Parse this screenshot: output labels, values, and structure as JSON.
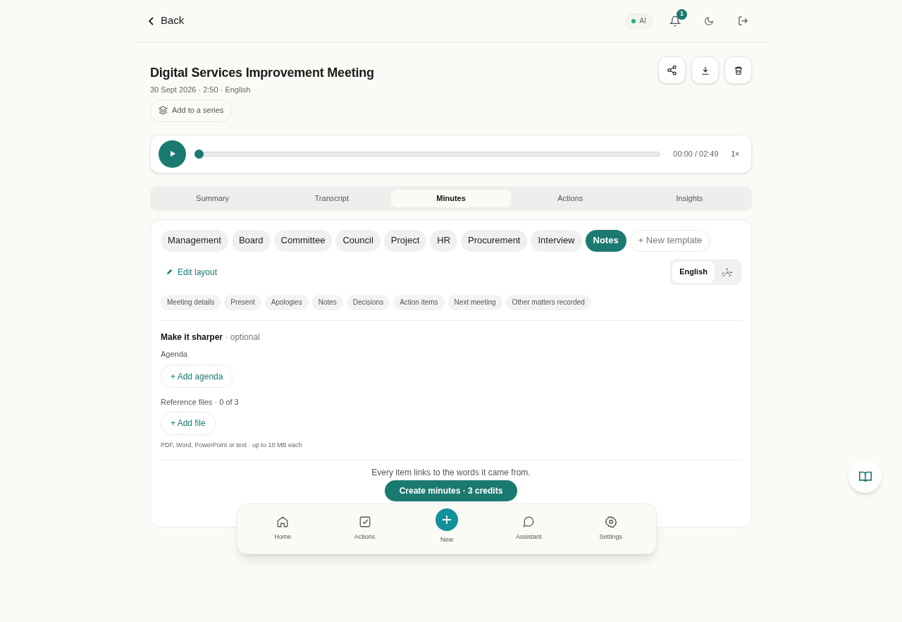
{
  "header": {
    "back": "Back",
    "ai_badge": "AI",
    "notifications_count": "1"
  },
  "meeting": {
    "title": "Digital Services Improvement Meeting",
    "meta": "30 Sept 2026 · 2:50 · English",
    "series_button": "Add to a series"
  },
  "player": {
    "time": "00:00 / 02:49",
    "speed": "1×",
    "level": 0
  },
  "tabs": [
    {
      "label": "Summary",
      "selected": false
    },
    {
      "label": "Transcript",
      "selected": false
    },
    {
      "label": "Minutes",
      "selected": true
    },
    {
      "label": "Actions",
      "selected": false
    },
    {
      "label": "Insights",
      "selected": false
    }
  ],
  "templates": [
    {
      "label": "Management",
      "selected": false
    },
    {
      "label": "Board",
      "selected": false
    },
    {
      "label": "Committee",
      "selected": false
    },
    {
      "label": "Council",
      "selected": false
    },
    {
      "label": "Project",
      "selected": false
    },
    {
      "label": "HR",
      "selected": false
    },
    {
      "label": "Procurement",
      "selected": false
    },
    {
      "label": "Interview",
      "selected": false
    },
    {
      "label": "Notes",
      "selected": true
    }
  ],
  "new_template": "+ New template",
  "edit_layout": "Edit layout",
  "languages": [
    {
      "label": "English",
      "selected": true
    },
    {
      "label": "ދިވެހި",
      "selected": false
    }
  ],
  "sections": [
    "Meeting details",
    "Present",
    "Apologies",
    "Notes",
    "Decisions",
    "Action items",
    "Next meeting",
    "Other matters recorded"
  ],
  "sharpen": {
    "title": "**Make it sharper** · optional",
    "agenda_label": "Agenda",
    "agenda_button": "+ Add agenda",
    "files_label": "Reference files · 0 of 3",
    "file_button": "+ Add file",
    "files_hint": "PDF, Word, PowerPoint or text · up to 10 MB each"
  },
  "footer_note": "Every item links to the words it came from.",
  "create_button": "Create minutes · 3 credits",
  "bottom_nav": [
    {
      "kind": "home",
      "label": "Home"
    },
    {
      "kind": "actions",
      "label": "Actions"
    },
    {
      "kind": "new",
      "label": "New"
    },
    {
      "kind": "assistant",
      "label": "Assistant"
    },
    {
      "kind": "settings",
      "label": "Settings"
    }
  ]
}
